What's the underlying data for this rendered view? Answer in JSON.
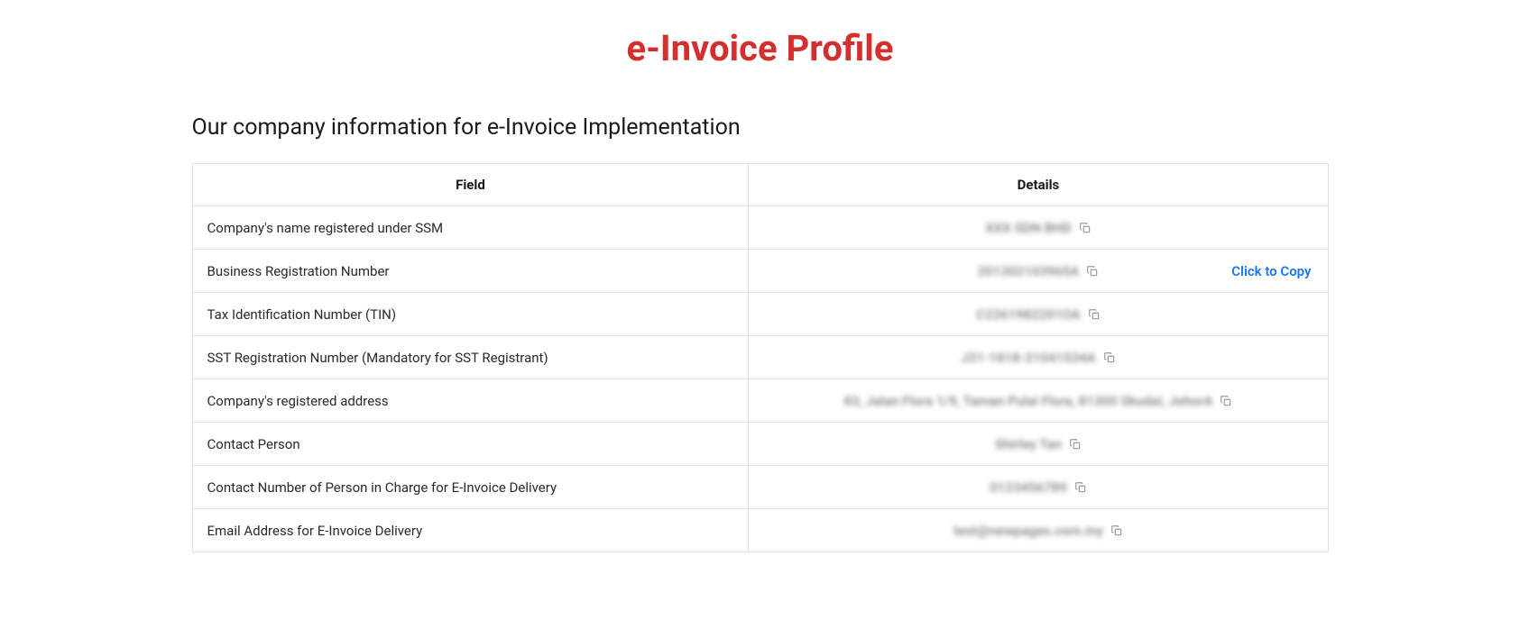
{
  "page_title": "e-Invoice Profile",
  "subtitle": "Our company information for e-Invoice Implementation",
  "table": {
    "headers": {
      "field": "Field",
      "details": "Details"
    },
    "click_to_copy": "Click to Copy",
    "rows": [
      {
        "field": "Company's name registered under SSM",
        "value": "XXX SDN BHD",
        "show_click_to_copy": false
      },
      {
        "field": "Business Registration Number",
        "value": "201302103965A",
        "show_click_to_copy": true
      },
      {
        "field": "Tax Identification Number (TIN)",
        "value": "C2261982201OA",
        "show_click_to_copy": false
      },
      {
        "field": "SST Registration Number (Mandatory for SST Registrant)",
        "value": "J31-1818-31041534A",
        "show_click_to_copy": false
      },
      {
        "field": "Company's registered address",
        "value": "83, Jalan Flora 1/9, Taman Pulai Flora, 81300 Skudai, JohorA",
        "show_click_to_copy": false
      },
      {
        "field": "Contact Person",
        "value": "Shirley Tan",
        "show_click_to_copy": false
      },
      {
        "field": "Contact Number of Person in Charge for E-Invoice Delivery",
        "value": "0123456789",
        "show_click_to_copy": false
      },
      {
        "field": "Email Address for E-Invoice Delivery",
        "value": "test@newpages.com.my",
        "show_click_to_copy": false
      }
    ]
  }
}
